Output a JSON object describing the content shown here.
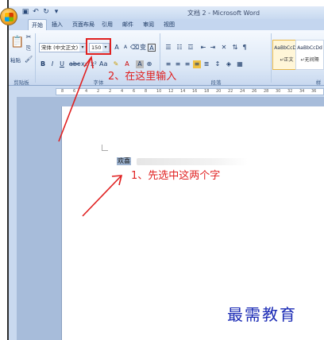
{
  "window": {
    "title": "文档 2 - Microsoft Word"
  },
  "tabs": [
    "开始",
    "插入",
    "页面布局",
    "引用",
    "邮件",
    "审阅",
    "视图"
  ],
  "ribbon": {
    "clipboard": {
      "paste_label": "粘贴",
      "group_label": "剪贴板"
    },
    "font": {
      "font_name": "宋体 (中文正文)",
      "font_size": "150",
      "group_label": "字体"
    },
    "paragraph": {
      "group_label": "段落"
    },
    "styles": [
      {
        "sample": "AaBbCcDd",
        "name": "↵正文"
      },
      {
        "sample": "AaBbCcDd",
        "name": "↵无间隔"
      }
    ],
    "styles_group_label": "样"
  },
  "ruler": {
    "numbers": [
      "8",
      "6",
      "4",
      "2",
      "2",
      "4",
      "6",
      "8",
      "10",
      "12",
      "14",
      "16",
      "18",
      "20",
      "22",
      "24",
      "26",
      "28",
      "30",
      "32",
      "34",
      "36"
    ]
  },
  "document": {
    "selected_text": "欢喜"
  },
  "annotations": {
    "step2": "2、在这里输入",
    "step1": "1、先选中这两个字",
    "watermark": "最需教育"
  },
  "colors": {
    "annotation": "#e02020",
    "watermark": "#1b2bb5"
  }
}
